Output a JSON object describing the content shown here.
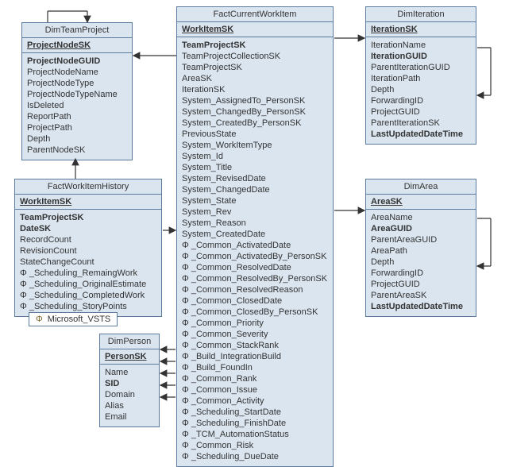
{
  "glyphs": {
    "phi": "Φ"
  },
  "legend": {
    "label": "Microsoft_VSTS"
  },
  "entities": {
    "dimTeamProject": {
      "title": "DimTeamProject",
      "pk": "ProjectNodeSK",
      "fields": [
        {
          "t": "ProjectNodeGUID",
          "bold": true
        },
        {
          "t": "ProjectNodeName"
        },
        {
          "t": "ProjectNodeType"
        },
        {
          "t": "ProjectNodeTypeName"
        },
        {
          "t": "IsDeleted"
        },
        {
          "t": "ReportPath"
        },
        {
          "t": "ProjectPath"
        },
        {
          "t": "Depth"
        },
        {
          "t": "ParentNodeSK"
        }
      ]
    },
    "factWorkItemHistory": {
      "title": "FactWorkItemHistory",
      "pk": "WorkItemSK",
      "fields": [
        {
          "t": "TeamProjectSK",
          "bold": true
        },
        {
          "t": "DateSK",
          "bold": true
        },
        {
          "t": "RecordCount"
        },
        {
          "t": "RevisionCount"
        },
        {
          "t": "StateChangeCount"
        },
        {
          "t": "_Scheduling_RemaingWork",
          "phi": true
        },
        {
          "t": "_Scheduling_OriginalEstimate",
          "phi": true
        },
        {
          "t": "_Scheduling_CompletedWork",
          "phi": true
        },
        {
          "t": "_Scheduling_StoryPoints",
          "phi": true
        }
      ]
    },
    "dimPerson": {
      "title": "DimPerson",
      "pk": "PersonSK",
      "fields": [
        {
          "t": "Name"
        },
        {
          "t": "SID",
          "bold": true
        },
        {
          "t": "Domain"
        },
        {
          "t": "Alias"
        },
        {
          "t": "Email"
        }
      ]
    },
    "factCurrentWorkItem": {
      "title": "FactCurrentWorkItem",
      "pk": "WorkItemSK",
      "fields": [
        {
          "t": "TeamProjectSK",
          "bold": true
        },
        {
          "t": "TeamProjectCollectionSK"
        },
        {
          "t": "TeamProjectSK"
        },
        {
          "t": "AreaSK"
        },
        {
          "t": "IterationSK"
        },
        {
          "t": "System_AssignedTo_PersonSK"
        },
        {
          "t": "System_ChangedBy_PersonSK"
        },
        {
          "t": "System_CreatedBy_PersonSK"
        },
        {
          "t": "PreviousState"
        },
        {
          "t": "System_WorkItemType"
        },
        {
          "t": "System_Id"
        },
        {
          "t": "System_Title"
        },
        {
          "t": "System_RevisedDate"
        },
        {
          "t": "System_ChangedDate"
        },
        {
          "t": "System_State"
        },
        {
          "t": "System_Rev"
        },
        {
          "t": "System_Reason"
        },
        {
          "t": "System_CreatedDate"
        },
        {
          "t": "_Common_ActivatedDate",
          "phi": true
        },
        {
          "t": "_Common_ActivatedBy_PersonSK",
          "phi": true
        },
        {
          "t": "_Common_ResolvedDate",
          "phi": true
        },
        {
          "t": "_Common_ResolvedBy_PersonSK",
          "phi": true
        },
        {
          "t": "_Common_ResolvedReason",
          "phi": true
        },
        {
          "t": "_Common_ClosedDate",
          "phi": true
        },
        {
          "t": "_Common_ClosedBy_PersonSK",
          "phi": true
        },
        {
          "t": "_Common_Priority",
          "phi": true
        },
        {
          "t": "_Common_Severity",
          "phi": true
        },
        {
          "t": "_Common_StackRank",
          "phi": true
        },
        {
          "t": "_Build_IntegrationBuild",
          "phi": true
        },
        {
          "t": "_Build_FoundIn",
          "phi": true
        },
        {
          "t": "_Common_Rank",
          "phi": true
        },
        {
          "t": "_Common_Issue",
          "phi": true
        },
        {
          "t": "_Common_Activity",
          "phi": true
        },
        {
          "t": "_Scheduling_StartDate",
          "phi": true
        },
        {
          "t": "_Scheduling_FinishDate",
          "phi": true
        },
        {
          "t": "_TCM_AutomationStatus",
          "phi": true
        },
        {
          "t": "_Common_Risk",
          "phi": true
        },
        {
          "t": "_Scheduling_DueDate",
          "phi": true
        }
      ]
    },
    "dimIteration": {
      "title": "DimIteration",
      "pk": "IterationSK",
      "fields": [
        {
          "t": "IterationName"
        },
        {
          "t": "IterationGUID",
          "bold": true
        },
        {
          "t": "ParentIterationGUID"
        },
        {
          "t": "IterationPath"
        },
        {
          "t": "Depth"
        },
        {
          "t": "ForwardingID"
        },
        {
          "t": "ProjectGUID"
        },
        {
          "t": "ParentIterationSK"
        },
        {
          "t": "LastUpdatedDateTime",
          "bold": true
        }
      ]
    },
    "dimArea": {
      "title": "DimArea",
      "pk": "AreaSK",
      "fields": [
        {
          "t": "AreaName"
        },
        {
          "t": "AreaGUID",
          "bold": true
        },
        {
          "t": "ParentAreaGUID"
        },
        {
          "t": "AreaPath"
        },
        {
          "t": "Depth"
        },
        {
          "t": "ForwardingID"
        },
        {
          "t": "ProjectGUID"
        },
        {
          "t": "ParentAreaSK"
        },
        {
          "t": "LastUpdatedDateTime",
          "bold": true
        }
      ]
    }
  }
}
